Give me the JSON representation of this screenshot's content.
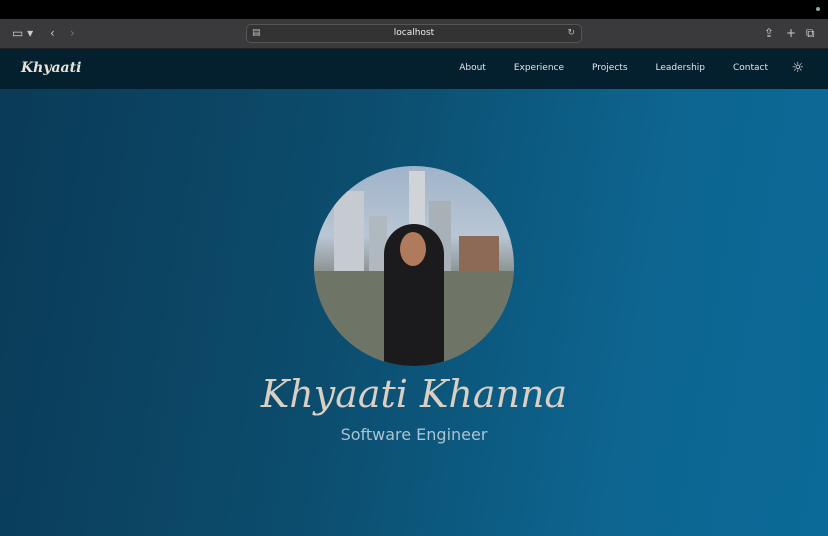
{
  "browser": {
    "url": "localhost"
  },
  "nav": {
    "logo": "Khyaati",
    "links": [
      "About",
      "Experience",
      "Projects",
      "Leadership",
      "Contact"
    ]
  },
  "hero": {
    "name": "Khyaati Khanna",
    "role": "Software Engineer"
  }
}
